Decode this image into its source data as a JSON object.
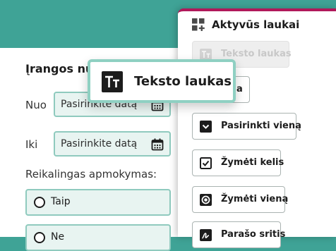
{
  "form": {
    "heading": "Įrangos nu",
    "from_label": "Nuo",
    "to_label": "Iki",
    "date_placeholder": "Pasirinkite datą",
    "payment_question": "Reikalingas apmokymas:",
    "options": [
      "Taip",
      "Ne"
    ]
  },
  "panel": {
    "title": "Aktyvūs laukai",
    "items": [
      {
        "label": "Teksto laukas",
        "icon": "text-field-icon",
        "disabled": true
      },
      {
        "label": "Data",
        "icon": "calendar-icon",
        "visible_text": "a"
      },
      {
        "label": "Pasirinkti vieną",
        "icon": "dropdown-icon"
      },
      {
        "label": "Žymėti kelis",
        "icon": "checkbox-icon"
      },
      {
        "label": "Žymėti vieną",
        "icon": "radio-icon"
      },
      {
        "label": "Parašo sritis",
        "icon": "signature-icon"
      }
    ]
  },
  "drag": {
    "label": "Teksto laukas",
    "icon": "text-field-icon"
  },
  "colors": {
    "teal": "#3fa396",
    "accent": "#b0195a",
    "field_bg": "#e8f4f1",
    "field_border": "#8fcabe"
  }
}
